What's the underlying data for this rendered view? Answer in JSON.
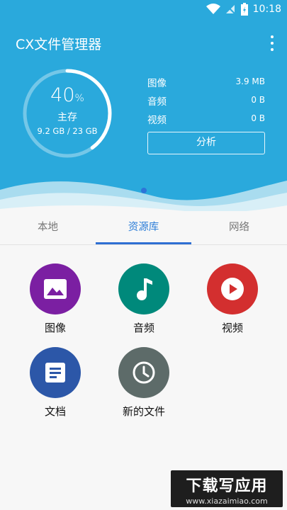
{
  "status": {
    "time": "10:18"
  },
  "app": {
    "title": "CX文件管理器"
  },
  "storage": {
    "percent": "40",
    "percent_sign": "%",
    "percent_fraction": 0.4,
    "label": "主存",
    "size": "9.2 GB / 23 GB"
  },
  "stats": [
    {
      "label": "图像",
      "value": "3.9 MB"
    },
    {
      "label": "音频",
      "value": "0 B"
    },
    {
      "label": "视频",
      "value": "0 B"
    }
  ],
  "analyze_label": "分析",
  "tabs": [
    {
      "label": "本地"
    },
    {
      "label": "资源库"
    },
    {
      "label": "网络"
    }
  ],
  "library": [
    {
      "label": "图像",
      "icon": "image-icon",
      "color": "#7b1fa2"
    },
    {
      "label": "音频",
      "icon": "music-note-icon",
      "color": "#00897b"
    },
    {
      "label": "视频",
      "icon": "play-circle-icon",
      "color": "#d32f2f"
    },
    {
      "label": "文档",
      "icon": "document-icon",
      "color": "#2c57a8"
    },
    {
      "label": "新的文件",
      "icon": "clock-icon",
      "color": "#5d6b69"
    }
  ],
  "watermark": {
    "title": "下载写应用",
    "url": "www.xiazaimiao.com"
  },
  "colors": {
    "header": "#2aa9dc",
    "accent": "#2f7fd8"
  }
}
